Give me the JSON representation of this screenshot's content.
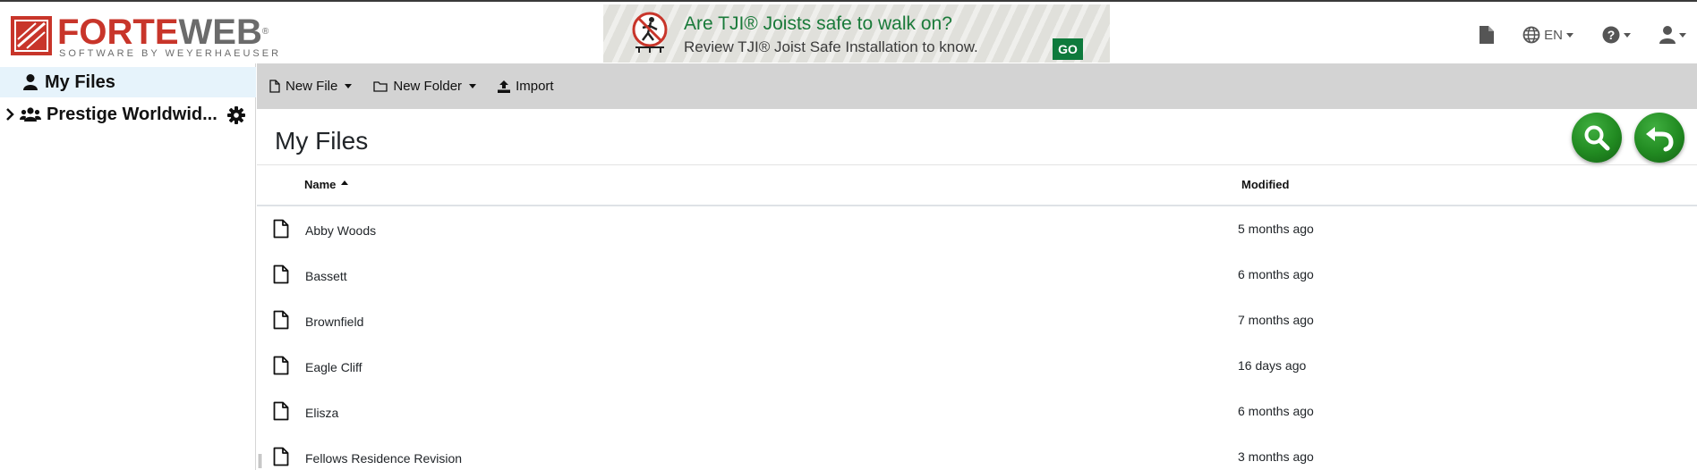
{
  "brand": {
    "name_part1": "FORTE",
    "name_part2": "WEB",
    "reg": "®",
    "tagline": "SOFTWARE BY WEYERHAEUSER"
  },
  "banner": {
    "title": "Are TJI® Joists safe to walk on?",
    "subtitle": "Review TJI® Joist Safe Installation to know.",
    "go_label": "GO"
  },
  "header": {
    "language": "EN",
    "icons": [
      "document-icon",
      "globe-icon",
      "help-icon",
      "user-icon"
    ]
  },
  "sidebar": {
    "items": [
      {
        "label": "My Files",
        "icon": "user-icon",
        "active": true
      },
      {
        "label": "Prestige Worldwid...",
        "icon": "users-icon",
        "active": false
      }
    ]
  },
  "toolbar": {
    "new_file": "New File",
    "new_folder": "New Folder",
    "import": "Import"
  },
  "main": {
    "title": "My Files",
    "columns": {
      "name": "Name",
      "modified": "Modified"
    },
    "files": [
      {
        "name": "Abby Woods",
        "modified": "5 months ago"
      },
      {
        "name": "Bassett",
        "modified": "6 months ago"
      },
      {
        "name": "Brownfield",
        "modified": "7 months ago"
      },
      {
        "name": "Eagle Cliff",
        "modified": "16 days ago"
      },
      {
        "name": "Elisza",
        "modified": "6 months ago"
      },
      {
        "name": "Fellows Residence Revision",
        "modified": "3 months ago"
      }
    ]
  },
  "colors": {
    "brand_red": "#c8352a",
    "brand_gray": "#6b6b6b",
    "active_bg": "#e6f3fb",
    "toolbar_bg": "#d3d3d3",
    "fab_green": "#218a21",
    "banner_green": "#1a7a3a"
  }
}
